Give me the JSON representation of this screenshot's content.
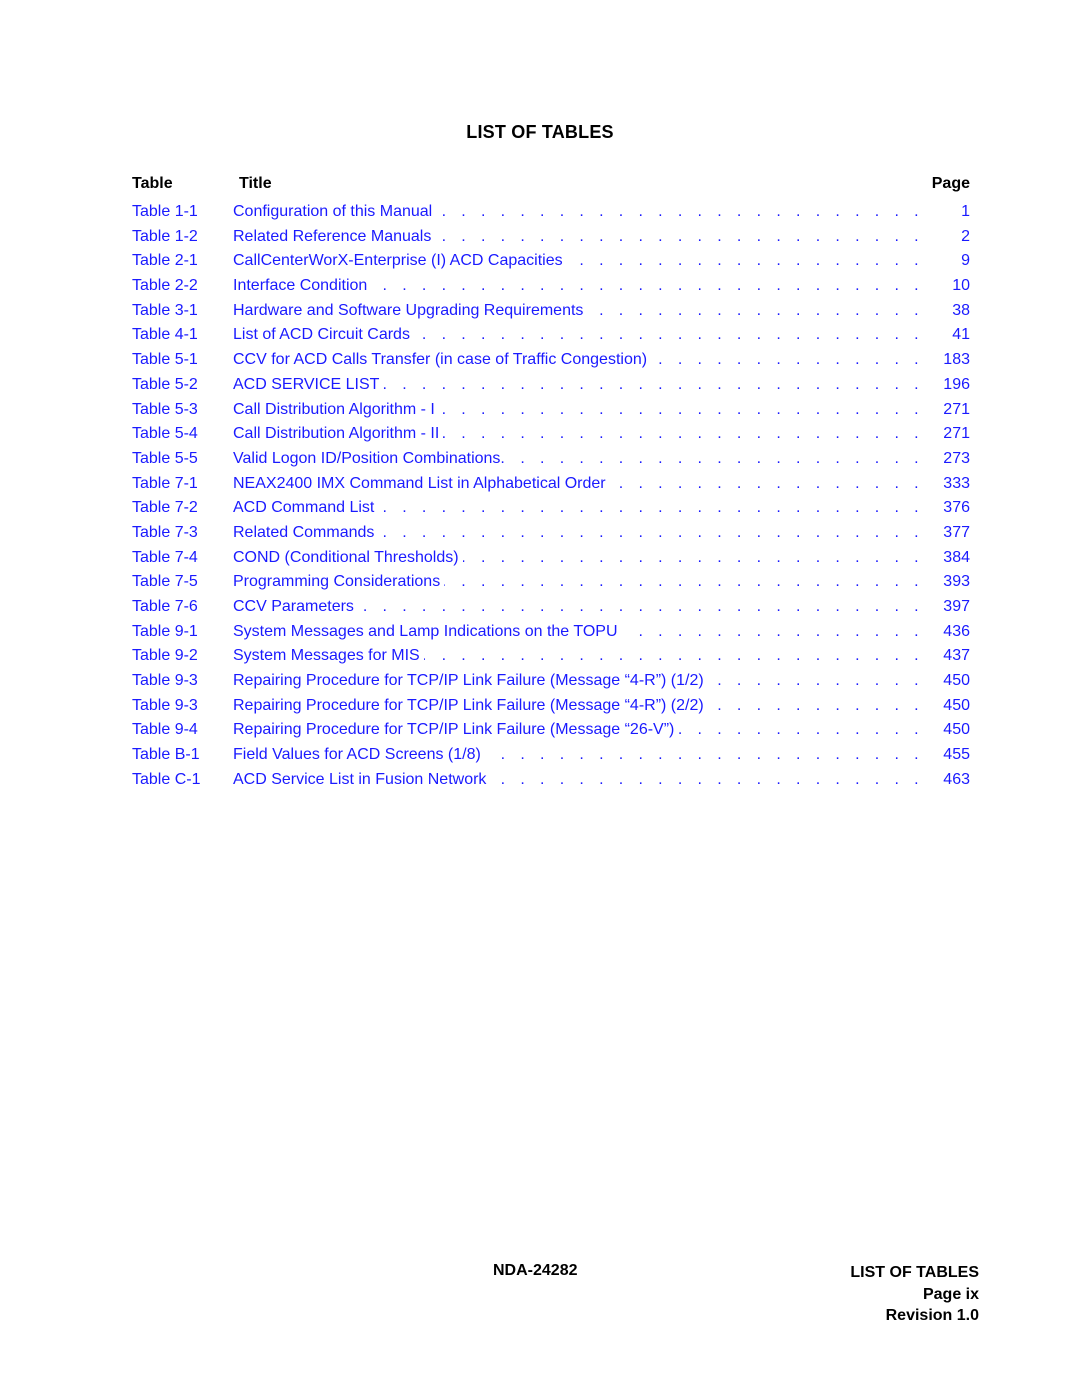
{
  "page_title": "LIST OF TABLES",
  "headers": {
    "table": "Table",
    "title": "Title",
    "page": "Page"
  },
  "link_color": "#1a1aff",
  "entries": [
    {
      "num": "Table 1-1",
      "title": "Configuration of this Manual",
      "page": "1"
    },
    {
      "num": "Table 1-2",
      "title": "Related Reference Manuals",
      "page": "2"
    },
    {
      "num": "Table 2-1",
      "title": "CallCenterWorX-Enterprise (I) ACD Capacities",
      "page": "9"
    },
    {
      "num": "Table 2-2",
      "title": "Interface Condition",
      "page": "10"
    },
    {
      "num": "Table 3-1",
      "title": "Hardware and Software Upgrading Requirements",
      "page": "38"
    },
    {
      "num": "Table 4-1",
      "title": "List of ACD Circuit Cards",
      "page": "41"
    },
    {
      "num": "Table 5-1",
      "title": "CCV for ACD Calls Transfer (in case of Traffic Congestion)",
      "page": "183"
    },
    {
      "num": "Table 5-2",
      "title": "ACD SERVICE LIST",
      "page": "196"
    },
    {
      "num": "Table 5-3",
      "title": "Call Distribution Algorithm - I",
      "page": "271"
    },
    {
      "num": "Table 5-4",
      "title": " Call Distribution Algorithm - II",
      "page": "271"
    },
    {
      "num": "Table 5-5",
      "title": "Valid Logon ID/Position Combinations.",
      "page": "273"
    },
    {
      "num": "Table 7-1",
      "title": "NEAX2400 IMX Command List in Alphabetical Order",
      "page": "333"
    },
    {
      "num": "Table 7-2",
      "title": "ACD Command List",
      "page": "376"
    },
    {
      "num": "Table 7-3",
      "title": "Related Commands",
      "page": "377"
    },
    {
      "num": "Table 7-4",
      "title": "COND (Conditional Thresholds)",
      "page": "384"
    },
    {
      "num": "Table 7-5",
      "title": "Programming Considerations",
      "page": "393"
    },
    {
      "num": "Table 7-6",
      "title": "CCV Parameters",
      "page": "397"
    },
    {
      "num": "Table 9-1",
      "title": "System Messages and Lamp Indications on the TOPU",
      "page": "436"
    },
    {
      "num": "Table 9-2",
      "title": "System Messages for MIS",
      "page": "437"
    },
    {
      "num": "Table 9-3",
      "title": "Repairing Procedure for TCP/IP Link Failure (Message “4-R”) (1/2)",
      "page": "450"
    },
    {
      "num": "Table 9-3",
      "title": "Repairing Procedure for TCP/IP Link Failure (Message “4-R”) (2/2)",
      "page": "450"
    },
    {
      "num": "Table 9-4",
      "title": "Repairing Procedure for TCP/IP Link Failure (Message “26-V”)",
      "page": "450"
    },
    {
      "num": "Table B-1",
      "title": "Field Values for ACD Screens  (1/8)",
      "page": "455"
    },
    {
      "num": "Table C-1",
      "title": "ACD Service List in Fusion Network",
      "page": "463"
    }
  ],
  "footer": {
    "doc_number": "NDA-24282",
    "section": "LIST OF TABLES",
    "page": "Page ix",
    "revision": "Revision 1.0"
  }
}
